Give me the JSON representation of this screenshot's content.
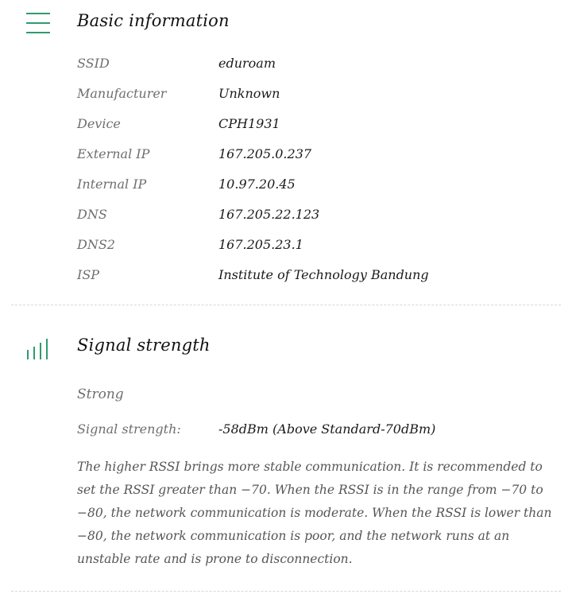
{
  "basic_info": {
    "title": "Basic information",
    "menu_icon": "menu-icon",
    "rows": [
      {
        "label": "SSID",
        "value": "eduroam"
      },
      {
        "label": "Manufacturer",
        "value": "Unknown"
      },
      {
        "label": "Device",
        "value": "CPH1931"
      },
      {
        "label": "External IP",
        "value": "167.205.0.237"
      },
      {
        "label": "Internal IP",
        "value": "10.97.20.45"
      },
      {
        "label": "DNS",
        "value": "167.205.22.123"
      },
      {
        "label": "DNS2",
        "value": "167.205.23.1"
      },
      {
        "label": "ISP",
        "value": "Institute of Technology Bandung"
      }
    ]
  },
  "signal": {
    "title": "Signal strength",
    "icon": "signal-bars-icon",
    "status": "Strong",
    "strength_label": "Signal strength:",
    "strength_value": "-58dBm  (Above Standard-70dBm)",
    "description": "The higher RSSI brings more stable communication. It is recommended to set the RSSI greater than −70. When the RSSI is in the range from −70 to −80, the network communication is moderate. When the RSSI is lower than −80, the network communication is poor, and the network runs at an unstable rate and is prone to disconnection."
  },
  "colors": {
    "accent": "#2e9b6e",
    "label": "#6e6e6e",
    "value": "#1a1a1a",
    "divider": "#d6d6d6"
  }
}
